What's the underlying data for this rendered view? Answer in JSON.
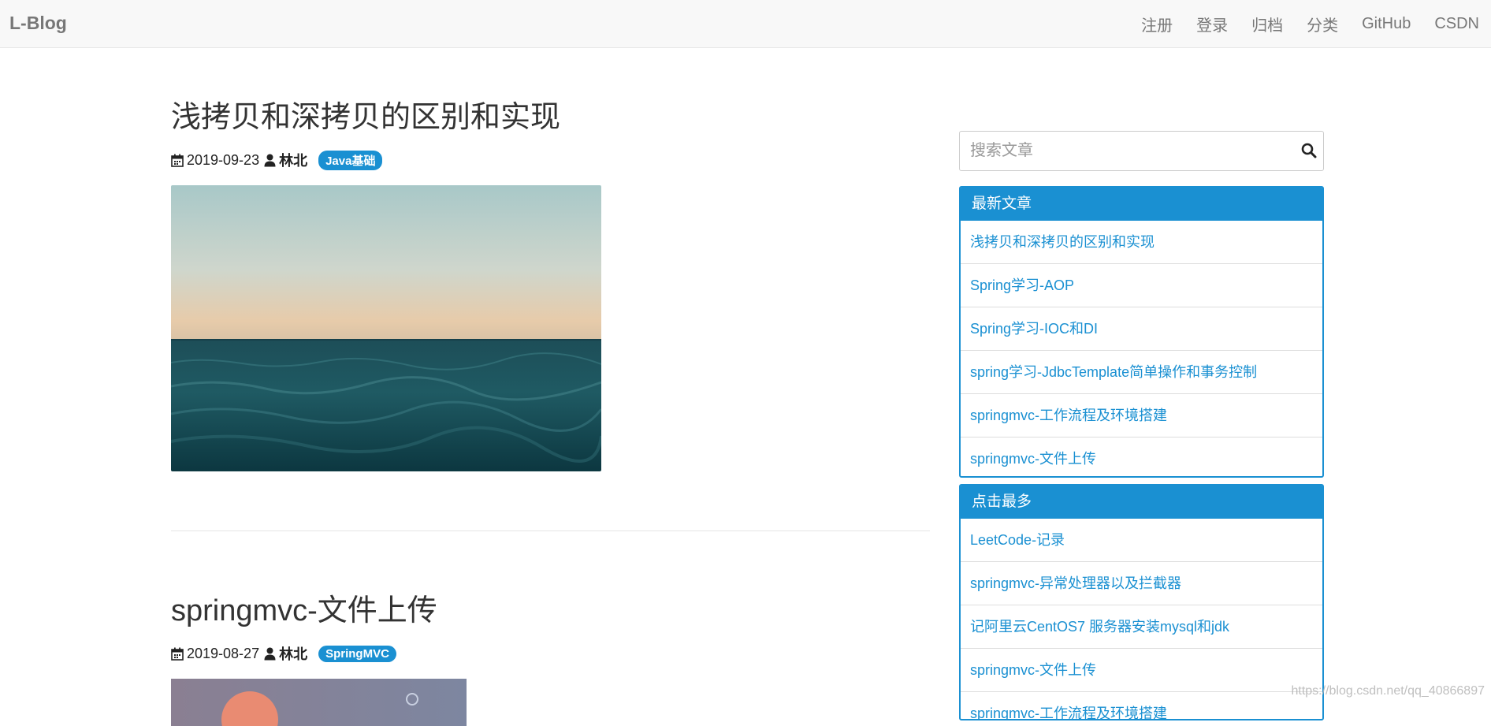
{
  "navbar": {
    "brand": "L-Blog",
    "links": [
      "注册",
      "登录",
      "归档",
      "分类",
      "GitHub",
      "CSDN"
    ]
  },
  "posts": [
    {
      "title": "浅拷贝和深拷贝的区别和实现",
      "date": "2019-09-23",
      "author": "林北",
      "tag": "Java基础",
      "image": "ocean-horizon"
    },
    {
      "title": "springmvc-文件上传",
      "date": "2019-08-27",
      "author": "林北",
      "tag": "SpringMVC",
      "image": "sunset"
    }
  ],
  "search": {
    "placeholder": "搜索文章"
  },
  "latest": {
    "heading": "最新文章",
    "items": [
      "浅拷贝和深拷贝的区别和实现",
      "Spring学习-AOP",
      "Spring学习-IOC和DI",
      "spring学习-JdbcTemplate简单操作和事务控制",
      "springmvc-工作流程及环境搭建",
      "springmvc-文件上传"
    ]
  },
  "popular": {
    "heading": "点击最多",
    "items": [
      "LeetCode-记录",
      "springmvc-异常处理器以及拦截器",
      "记阿里云CentOS7 服务器安装mysql和jdk",
      "springmvc-文件上传",
      "springmvc-工作流程及环境搭建"
    ]
  },
  "watermark": "https://blog.csdn.net/qq_40866897",
  "icons": {
    "date": "calendar-icon",
    "author": "user-icon",
    "search": "search-icon"
  },
  "colors": {
    "accent": "#1a90d2",
    "navbar_bg": "#f8f8f8"
  }
}
